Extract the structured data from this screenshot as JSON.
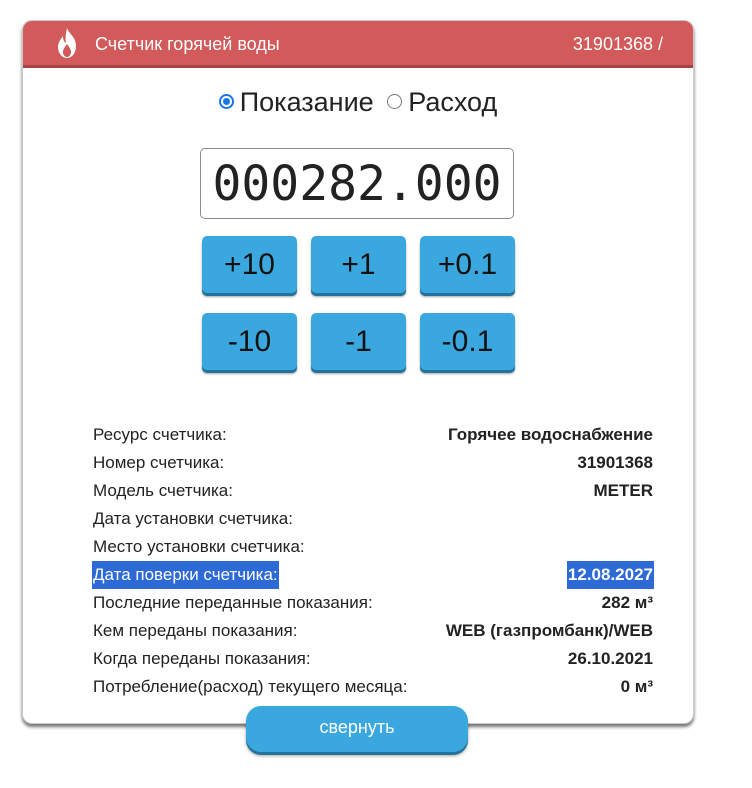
{
  "header": {
    "title": "Счетчик горячей воды",
    "serial": "31901368 /",
    "icon": "flame-icon",
    "bg_color": "#d25a5a"
  },
  "mode": {
    "options": [
      {
        "label": "Показание",
        "checked": true
      },
      {
        "label": "Расход",
        "checked": false
      }
    ]
  },
  "reading": {
    "value": "000282.000"
  },
  "buttons": {
    "row1": [
      "+10",
      "+1",
      "+0.1"
    ],
    "row2": [
      "-10",
      "-1",
      "-0.1"
    ],
    "color": "#3aa7de"
  },
  "info": {
    "rows": [
      {
        "label": "Ресурс счетчика:",
        "value": "Горячее водоснабжение"
      },
      {
        "label": "Номер счетчика:",
        "value": "31901368"
      },
      {
        "label": "Модель счетчика:",
        "value": "METER"
      },
      {
        "label": "Дата установки счетчика:",
        "value": ""
      },
      {
        "label": "Место установки счетчика:",
        "value": ""
      },
      {
        "label": "Дата поверки счетчика:",
        "value": "12.08.2027",
        "selected": true
      },
      {
        "label": "Последние переданные показания:",
        "value": "282 м³"
      },
      {
        "label": "Кем переданы показания:",
        "value": "WEB (газпромбанк)/WEB"
      },
      {
        "label": "Когда переданы показания:",
        "value": "26.10.2021"
      },
      {
        "label": "Потребление(расход) текущего месяца:",
        "value": "0 м³"
      }
    ]
  },
  "collapse": {
    "label": "свернуть"
  }
}
